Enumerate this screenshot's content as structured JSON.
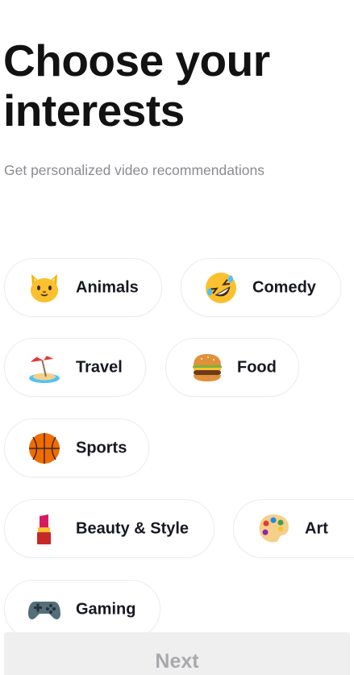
{
  "header": {
    "title": "Choose your interests",
    "subtitle": "Get personalized video recommendations"
  },
  "interests": [
    {
      "label": "Animals",
      "icon": "cat-face-icon"
    },
    {
      "label": "Comedy",
      "icon": "rolling-laughing-face-icon"
    },
    {
      "label": "Travel",
      "icon": "beach-umbrella-icon"
    },
    {
      "label": "Food",
      "icon": "hamburger-icon"
    },
    {
      "label": "Sports",
      "icon": "basketball-icon"
    },
    {
      "label": "Beauty & Style",
      "icon": "lipstick-icon"
    },
    {
      "label": "Art",
      "icon": "artist-palette-icon"
    },
    {
      "label": "Gaming",
      "icon": "game-controller-icon"
    }
  ],
  "footer": {
    "next_label": "Next",
    "next_enabled": false
  },
  "colors": {
    "title": "#121212",
    "subtitle": "#8a8b91",
    "chip_border": "#ececee",
    "next_background": "#efeff0",
    "next_text_disabled": "#a8a9ad"
  }
}
